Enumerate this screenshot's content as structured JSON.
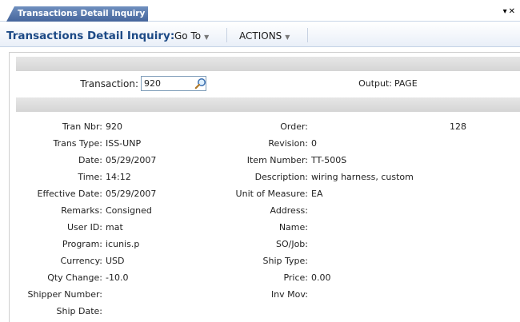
{
  "tab": {
    "label": "Transactions Detail Inquiry"
  },
  "toolbar": {
    "title": "Transactions Detail Inquiry:",
    "go_to": "Go To",
    "actions": "ACTIONS"
  },
  "header": {
    "transaction_label": "Transaction:",
    "transaction_value": "920",
    "output_label": "Output:",
    "output_value": "PAGE"
  },
  "left_fields": [
    {
      "label": "Tran Nbr:",
      "value": "920"
    },
    {
      "label": "Trans Type:",
      "value": "ISS-UNP"
    },
    {
      "label": "Date:",
      "value": "05/29/2007"
    },
    {
      "label": "Time:",
      "value": "14:12"
    },
    {
      "label": "Effective Date:",
      "value": "05/29/2007"
    },
    {
      "label": "Remarks:",
      "value": "Consigned"
    },
    {
      "label": "User ID:",
      "value": "mat"
    },
    {
      "label": "Program:",
      "value": "icunis.p"
    },
    {
      "label": "Currency:",
      "value": "USD"
    },
    {
      "label": "Qty Change:",
      "value": "-10.0"
    },
    {
      "label": "Shipper Number:",
      "value": ""
    },
    {
      "label": "Ship Date:",
      "value": ""
    }
  ],
  "right_fields": [
    {
      "label": "Order:",
      "value": "",
      "extra": "128"
    },
    {
      "label": "Revision:",
      "value": "0"
    },
    {
      "label": "Item Number:",
      "value": "TT-500S"
    },
    {
      "label": "Description:",
      "value": "wiring harness, custom"
    },
    {
      "label": "Unit of Measure:",
      "value": "EA"
    },
    {
      "label": "Address:",
      "value": ""
    },
    {
      "label": "Name:",
      "value": ""
    },
    {
      "label": "SO/Job:",
      "value": ""
    },
    {
      "label": "Ship Type:",
      "value": ""
    },
    {
      "label": "Price:",
      "value": "0.00"
    },
    {
      "label": "Inv Mov:",
      "value": ""
    }
  ],
  "icons": {
    "lookup": "magnifier-icon",
    "dropdown": "caret-down-icon",
    "close": "close-icon"
  }
}
